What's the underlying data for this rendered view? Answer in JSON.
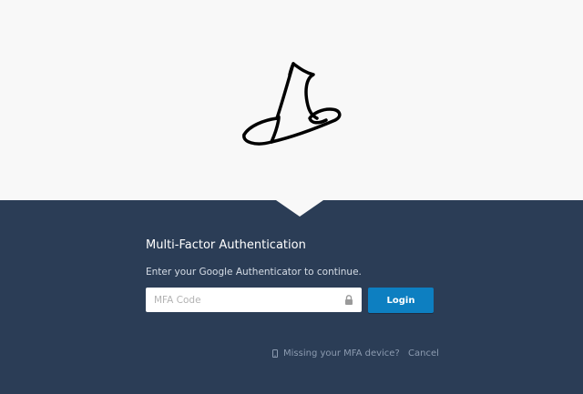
{
  "logo": {
    "icon": "wizard-hat-icon"
  },
  "mfa": {
    "title": "Multi-Factor Authentication",
    "subtitle": "Enter your Google Authenticator to continue.",
    "code_placeholder": "MFA Code",
    "code_value": "",
    "login_label": "Login",
    "missing_device_label": "Missing your MFA device?",
    "cancel_label": "Cancel"
  },
  "colors": {
    "header_bg": "#f8f8f8",
    "panel_bg": "#2b3d56",
    "accent": "#0d7fc1",
    "muted_link": "#8c9bb0"
  }
}
